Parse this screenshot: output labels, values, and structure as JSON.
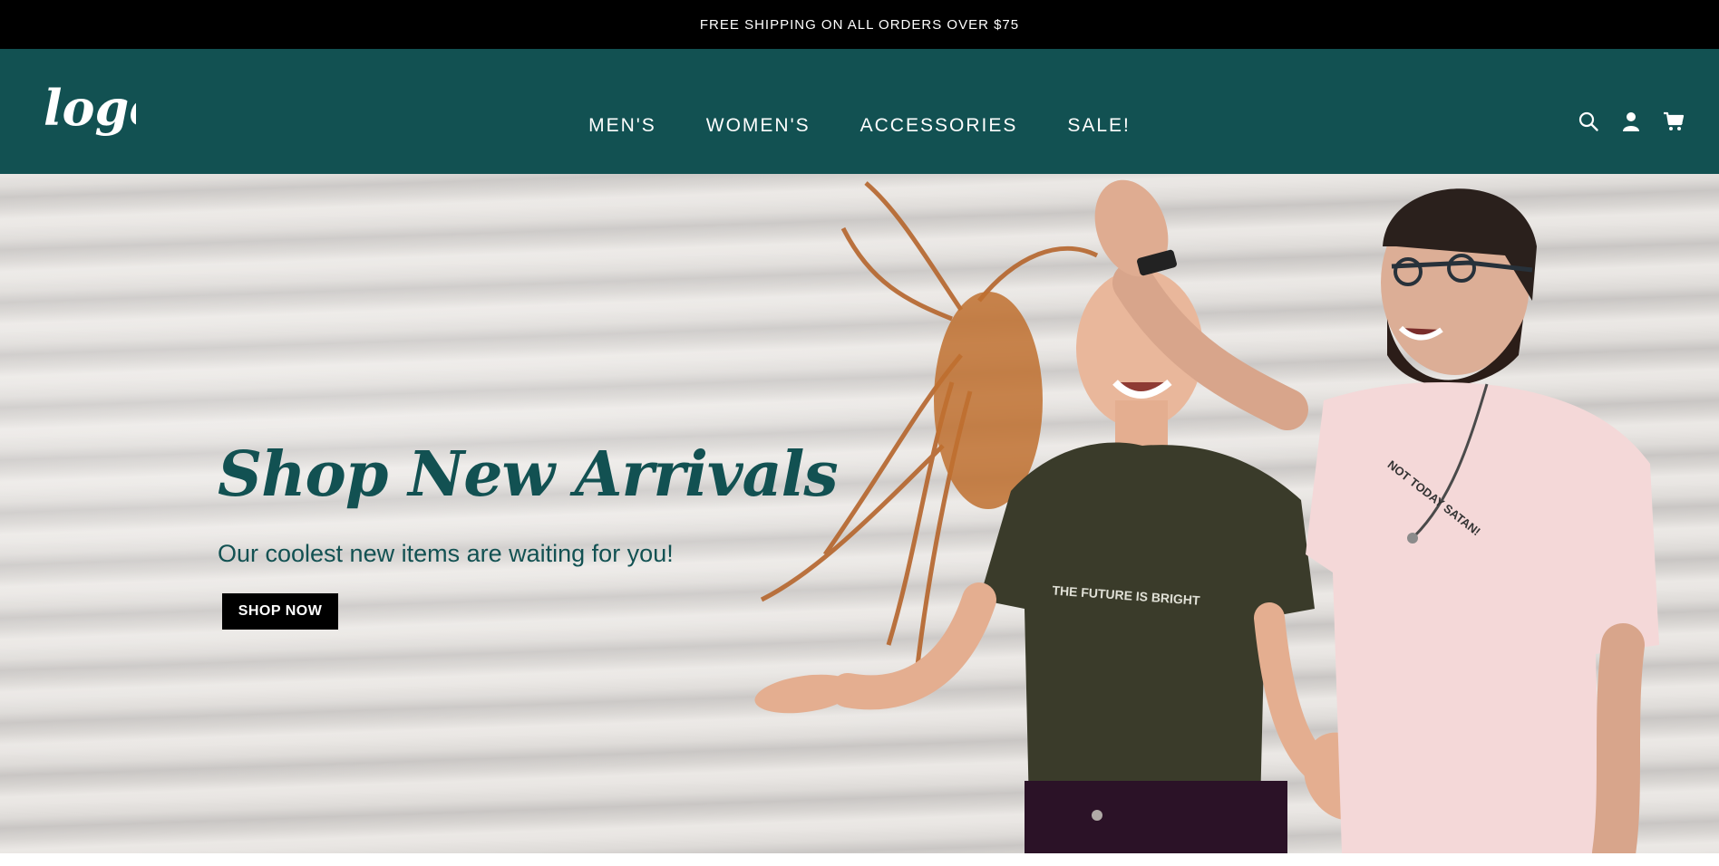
{
  "announcement": {
    "text": "FREE SHIPPING ON ALL ORDERS OVER $75"
  },
  "header": {
    "logo_text": "logo",
    "nav": [
      {
        "label": "MEN'S"
      },
      {
        "label": "WOMEN'S"
      },
      {
        "label": "ACCESSORIES"
      },
      {
        "label": "SALE!"
      }
    ],
    "icons": [
      "search-icon",
      "account-icon",
      "cart-icon"
    ]
  },
  "hero": {
    "title": "Shop New Arrivals",
    "subtitle": "Our coolest new items are waiting for you!",
    "cta_label": "SHOP NOW",
    "shirt_left_text": "THE FUTURE IS BRIGHT",
    "shirt_right_text": "NOT TODAY SATAN!"
  },
  "colors": {
    "brand": "#125152",
    "announcement_bg": "#000000",
    "button_bg": "#000000"
  }
}
